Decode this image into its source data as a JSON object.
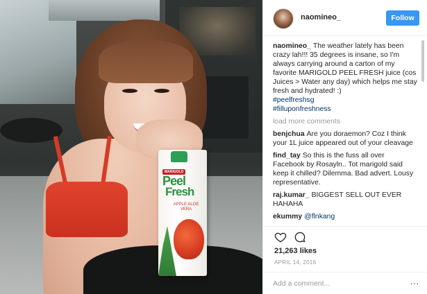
{
  "post": {
    "username": "naomineo_",
    "follow_label": "Follow",
    "caption_user": "naomineo_",
    "caption_text": "The weather lately has been crazy lah!!! 35 degrees is insane, so I'm always carrying around a carton of my favorite MARIGOLD PEEL FRESH juice (cos Juices > Water any day) which helps me stay fresh and hydrated! :)",
    "hashtags": [
      "#peelfreshsg",
      "#fillupon​freshness"
    ],
    "load_more": "load more comments",
    "comments": [
      {
        "user": "benjchua",
        "text": "Are you doraemon? Coz I think your 1L juice appeared out of your cleavage"
      },
      {
        "user": "find_tay",
        "text": "So this is the fuss all over Facebook by Rosayln.. Tot marigold said keep it chilled? Dilemma. Bad advert. Lousy representative."
      },
      {
        "user": "raj.kumar_",
        "text": "BIGGEST SELL OUT EVER HAHAHA"
      },
      {
        "user": "ekummy",
        "text": "@flnkang"
      }
    ],
    "likes": "21,263 likes",
    "date": "APRIL 14, 2016",
    "add_comment_placeholder": "Add a comment...",
    "more_label": "..."
  },
  "photo": {
    "carton_brand": "MARIGOLD",
    "carton_line1": "Peel",
    "carton_line2": "Fresh",
    "carton_flavor": "APPLE ALOE VERA"
  },
  "colors": {
    "follow_button": "#3897f0",
    "link": "#003569",
    "muted": "#999999"
  },
  "icons": [
    "heart-icon",
    "comment-icon",
    "more-icon"
  ]
}
